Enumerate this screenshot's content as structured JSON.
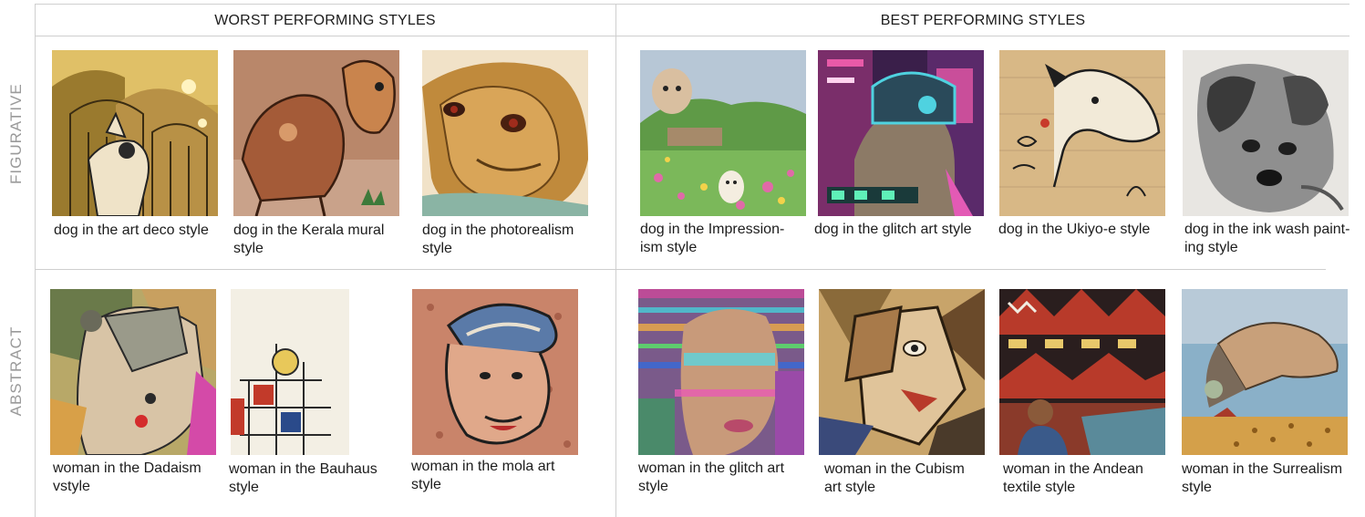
{
  "headers": {
    "worst": "WORST PERFORMING STYLES",
    "best": "BEST PERFORMING STYLES"
  },
  "row_labels": {
    "figurative": "FIGURATIVE",
    "abstract": "ABSTRACT"
  },
  "figurative": {
    "worst": [
      {
        "line1": "dog in the art deco style",
        "line2": ""
      },
      {
        "line1": "dog in the Kerala mural",
        "line2": "style"
      },
      {
        "line1": "dog in the photorealism",
        "line2": "style"
      }
    ],
    "best": [
      {
        "line1": "dog in the Impression-",
        "line2": "ism style"
      },
      {
        "line1": "dog in the glitch art style",
        "line2": ""
      },
      {
        "line1": "dog in the Ukiyo-e style",
        "line2": ""
      },
      {
        "line1": "dog in the ink wash paint-",
        "line2": "ing style"
      }
    ]
  },
  "abstract": {
    "worst": [
      {
        "line1": "woman in the Dadaism",
        "line2": "vstyle"
      },
      {
        "line1": "woman in the Bauhaus",
        "line2": "style"
      },
      {
        "line1": "woman in the mola art",
        "line2": "style"
      }
    ],
    "best": [
      {
        "line1": "woman in the glitch art",
        "line2": "style"
      },
      {
        "line1": "woman in the Cubism",
        "line2": " art style"
      },
      {
        "line1": "woman in the Andean",
        "line2": "textile style"
      },
      {
        "line1": "woman in the Surrealism",
        "line2": "style"
      }
    ]
  }
}
